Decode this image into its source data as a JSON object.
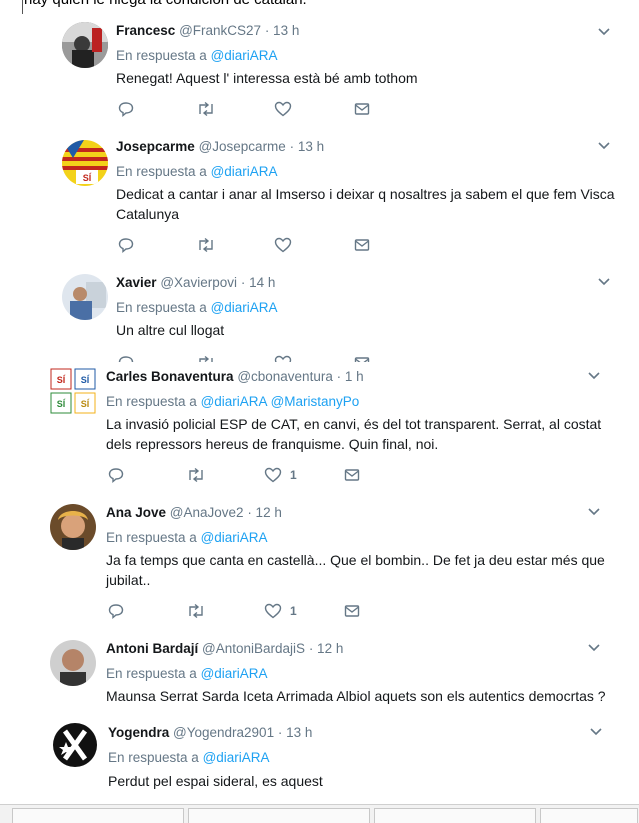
{
  "caption": "hay quien le niega la condición de catalán.",
  "reply_prefix": "En respuesta a",
  "tweets": [
    {
      "name": "Francesc",
      "handle": "@FrankCS27",
      "time": "· 13 h",
      "reply_to": [
        "@diariARA"
      ],
      "text": "Renegat! Aquest l' interessa està bé amb tothom",
      "likes": ""
    },
    {
      "name": "Josepcarme",
      "handle": "@Josepcarme",
      "time": "· 13 h",
      "reply_to": [
        "@diariARA"
      ],
      "text": "Dedicat a cantar i anar al Imserso i deixar q nosaltres ja sabem el que fem Visca Catalunya",
      "likes": ""
    },
    {
      "name": "Xavier",
      "handle": "@Xavierpovi",
      "time": "· 14 h",
      "reply_to": [
        "@diariARA"
      ],
      "text": "Un altre cul llogat",
      "likes": ""
    },
    {
      "name": "Carles Bonaventura",
      "handle": "@cbonaventura",
      "time": "· 1 h",
      "reply_to": [
        "@diariARA",
        "@MaristanyPo"
      ],
      "text": "La invasió policial ESP de CAT, en canvi, és del tot transparent. Serrat, al costat dels repressors hereus de franquisme. Quin final, noi.",
      "likes": "1"
    },
    {
      "name": "Ana Jove",
      "handle": "@AnaJove2",
      "time": "· 12 h",
      "reply_to": [
        "@diariARA"
      ],
      "text": "Ja fa temps que canta en castellà... Que el bombin.. De fet ja deu estar més que jubilat..",
      "likes": "1"
    },
    {
      "name": "Antoni Bardají",
      "handle": "@AntoniBardajiS",
      "time": "· 12 h",
      "reply_to": [
        "@diariARA"
      ],
      "text": "Maunsa Serrat  Sarda Iceta Arrimada Albiol aquets son els autentics democrtas ?",
      "likes": ""
    },
    {
      "name": "Yogendra",
      "handle": "@Yogendra2901",
      "time": "· 13 h",
      "reply_to": [
        "@diariARA"
      ],
      "text": "Perdut pel espai sideral, es aquest",
      "likes": ""
    }
  ],
  "si_badge": "SÍ",
  "colors": {
    "blue": "#1da1f2",
    "gray": "#657786",
    "text": "#14171a",
    "divider": "#e6ecf0"
  }
}
